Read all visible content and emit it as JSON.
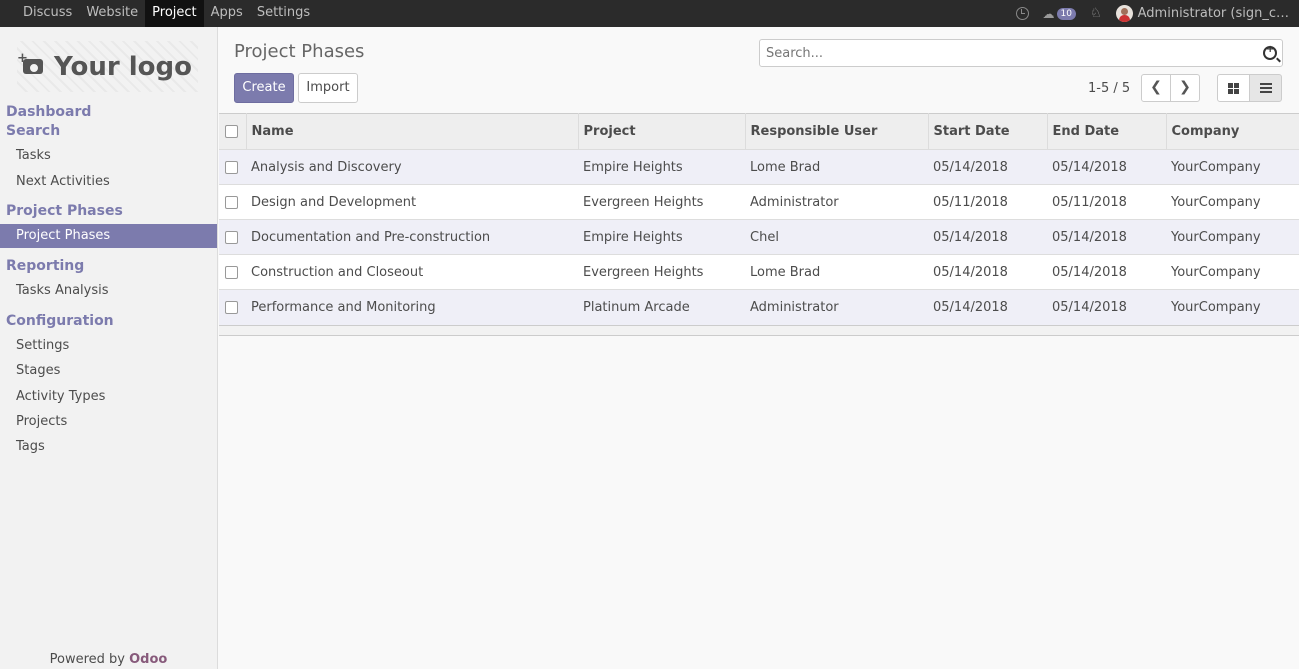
{
  "topbar": {
    "menu": [
      "Discuss",
      "Website",
      "Project",
      "Apps",
      "Settings"
    ],
    "active_menu": "Project",
    "message_count": "10",
    "user": "Administrator (sign_c…"
  },
  "sidebar": {
    "logo_text": "Your logo",
    "sections": [
      {
        "label": "Dashboard"
      },
      {
        "label": "Search",
        "items": [
          "Tasks",
          "Next Activities"
        ]
      },
      {
        "label": "Project Phases",
        "items": [
          "Project Phases"
        ]
      },
      {
        "label": "Reporting",
        "items": [
          "Tasks Analysis"
        ]
      },
      {
        "label": "Configuration",
        "items": [
          "Settings",
          "Stages",
          "Activity Types",
          "Projects",
          "Tags"
        ]
      }
    ],
    "active_item": "Project Phases",
    "powered_by": "Powered by",
    "brand": "Odoo"
  },
  "control_panel": {
    "title": "Project Phases",
    "search_placeholder": "Search...",
    "create_label": "Create",
    "import_label": "Import",
    "pager": "1-5 / 5",
    "active_view": "list"
  },
  "table": {
    "columns": [
      "Name",
      "Project",
      "Responsible User",
      "Start Date",
      "End Date",
      "Company"
    ],
    "rows": [
      [
        "Analysis and Discovery",
        "Empire Heights",
        "Lome Brad",
        "05/14/2018",
        "05/14/2018",
        "YourCompany"
      ],
      [
        "Design and Development",
        "Evergreen Heights",
        "Administrator",
        "05/11/2018",
        "05/11/2018",
        "YourCompany"
      ],
      [
        "Documentation and Pre-construction",
        "Empire Heights",
        "Chel",
        "05/14/2018",
        "05/14/2018",
        "YourCompany"
      ],
      [
        "Construction and Closeout",
        "Evergreen Heights",
        "Lome Brad",
        "05/14/2018",
        "05/14/2018",
        "YourCompany"
      ],
      [
        "Performance and Monitoring",
        "Platinum Arcade",
        "Administrator",
        "05/14/2018",
        "05/14/2018",
        "YourCompany"
      ]
    ]
  },
  "colors": {
    "accent": "#7c7bad",
    "navbar": "#2b2b2b",
    "brand": "#875a7b"
  }
}
